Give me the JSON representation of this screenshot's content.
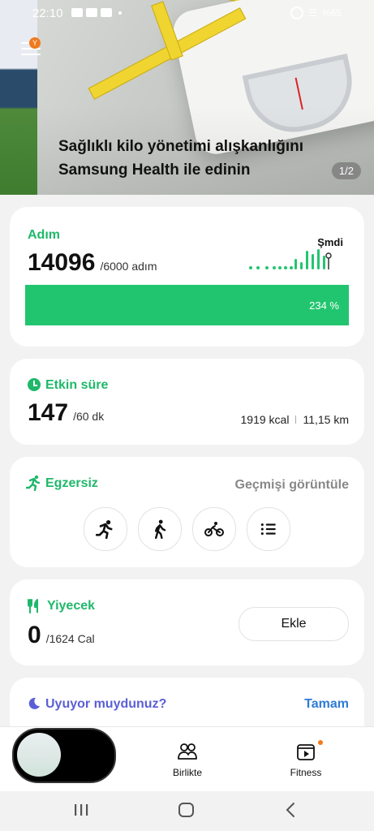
{
  "status_bar": {
    "time": "22:10",
    "battery": "%65"
  },
  "banner": {
    "title": "Sağlıklı kilo yönetimi alışkanlığını Samsung Health ile edinin",
    "page_indicator": "1/2",
    "menu_badge": "Y"
  },
  "steps": {
    "title": "Adım",
    "value": "14096",
    "goal": "/6000 adım",
    "now_label": "Şmdi",
    "progress_label": "234 %",
    "progress_fraction": 1.0
  },
  "active": {
    "title": "Etkin süre",
    "value": "147",
    "goal": "/60 dk",
    "kcal": "1919 kcal",
    "distance": "11,15 km"
  },
  "exercise": {
    "title": "Egzersiz",
    "history_label": "Geçmişi görüntüle",
    "buttons": [
      "running-icon",
      "walking-icon",
      "cycling-icon",
      "list-icon"
    ]
  },
  "food": {
    "title": "Yiyecek",
    "value": "0",
    "goal": "/1624 Cal",
    "add_label": "Ekle"
  },
  "sleep": {
    "title": "Uyuyor muydunuz?",
    "done_label": "Tamam"
  },
  "bottom_nav": {
    "together": "Birlikte",
    "fitness": "Fitness"
  },
  "colors": {
    "accent_green": "#1fb86a",
    "progress_green": "#22c56f",
    "sleep_purple": "#5b5fd6",
    "link_blue": "#2e7bd6",
    "badge_orange": "#f07a1e"
  }
}
